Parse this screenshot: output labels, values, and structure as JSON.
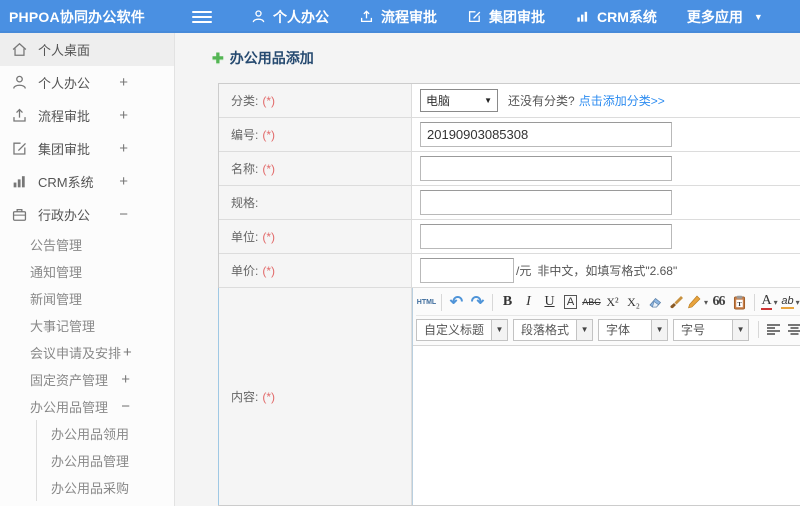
{
  "topbar": {
    "brand": "PHPOA协同办公软件",
    "nav": [
      {
        "icon": "user-icon",
        "label": "个人办公"
      },
      {
        "icon": "upload-icon",
        "label": "流程审批"
      },
      {
        "icon": "edit-icon",
        "label": "集团审批"
      },
      {
        "icon": "chart-icon",
        "label": "CRM系统"
      },
      {
        "icon": "caret-down-icon",
        "label": "更多应用"
      }
    ]
  },
  "sidebar": {
    "items": [
      {
        "label": "个人桌面",
        "icon": "home-icon",
        "expand": ""
      },
      {
        "label": "个人办公",
        "icon": "user-icon",
        "expand": "+"
      },
      {
        "label": "流程审批",
        "icon": "upload-icon",
        "expand": "+"
      },
      {
        "label": "集团审批",
        "icon": "edit-icon",
        "expand": "+"
      },
      {
        "label": "CRM系统",
        "icon": "chart-icon",
        "expand": "+"
      },
      {
        "label": "行政办公",
        "icon": "briefcase-icon",
        "expand": "−"
      },
      {
        "label": "公告管理",
        "expand": ""
      },
      {
        "label": "通知管理",
        "expand": ""
      },
      {
        "label": "新闻管理",
        "expand": ""
      },
      {
        "label": "大事记管理",
        "expand": ""
      },
      {
        "label": "会议申请及安排",
        "expand": "+"
      },
      {
        "label": "固定资产管理",
        "expand": "+"
      },
      {
        "label": "办公用品管理",
        "expand": "−"
      },
      {
        "label": "办公用品领用",
        "expand": ""
      },
      {
        "label": "办公用品管理",
        "expand": ""
      },
      {
        "label": "办公用品采购",
        "expand": ""
      }
    ]
  },
  "main": {
    "title": "办公用品添加",
    "form": {
      "category": {
        "label": "分类:",
        "required": "(*)",
        "select_value": "电脑",
        "question": "还没有分类?",
        "link": "点击添加分类>>"
      },
      "code": {
        "label": "编号:",
        "required": "(*)",
        "value": "20190903085308"
      },
      "name": {
        "label": "名称:",
        "required": "(*)",
        "value": ""
      },
      "spec": {
        "label": "规格:",
        "required": "",
        "value": ""
      },
      "unit": {
        "label": "单位:",
        "required": "(*)",
        "value": ""
      },
      "price": {
        "label": "单价:",
        "required": "(*)",
        "value": "",
        "suffix": "/元",
        "hint": "非中文，如填写格式\"2.68\""
      },
      "content": {
        "label": "内容:",
        "required": "(*)"
      }
    }
  },
  "editor": {
    "buttons": {
      "html": "HTML",
      "undo": "↶",
      "redo": "↷",
      "bold": "B",
      "italic": "I",
      "underline": "U",
      "char_border": "A",
      "strikethrough": "ABC",
      "superscript": "X²",
      "subscript": "X₂",
      "blockquote": "66",
      "font_color": "A",
      "highlight": "ab",
      "dropdown_arrow": "▾"
    },
    "dropdowns": [
      "自定义标题",
      "段落格式",
      "字体",
      "字号"
    ]
  },
  "colors": {
    "topbar_blue": "#4a90e2",
    "title_navy": "#264a70",
    "link_blue": "#2d8cf0",
    "required_red": "#e26a6a",
    "plus_green": "#54b554",
    "label_bg": "#f5f5f5",
    "content_row_accent": "#9fc8e4"
  }
}
